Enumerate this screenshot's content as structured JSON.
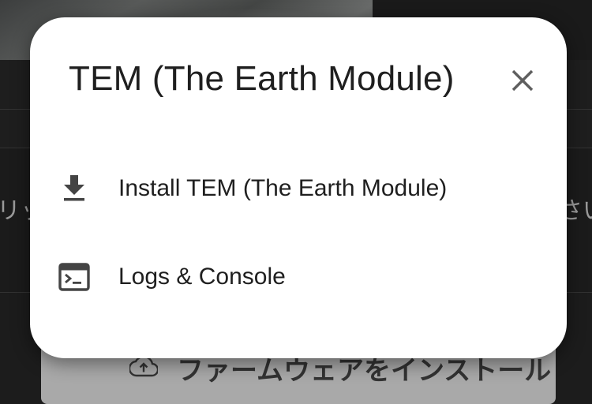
{
  "background": {
    "text_left": "リッ",
    "text_right": "さい",
    "install_button_label": "ファームウェアをインストール"
  },
  "dialog": {
    "title": "TEM (The Earth Module)",
    "close_icon": "close-icon",
    "items": [
      {
        "label": "Install TEM (The Earth Module)",
        "icon": "download-icon"
      },
      {
        "label": "Logs & Console",
        "icon": "terminal-icon"
      }
    ]
  },
  "colors": {
    "dialog_background": "#ffffff",
    "text": "#1f1f1f",
    "icon": "#444444",
    "background_page": "#1c1c1c"
  }
}
